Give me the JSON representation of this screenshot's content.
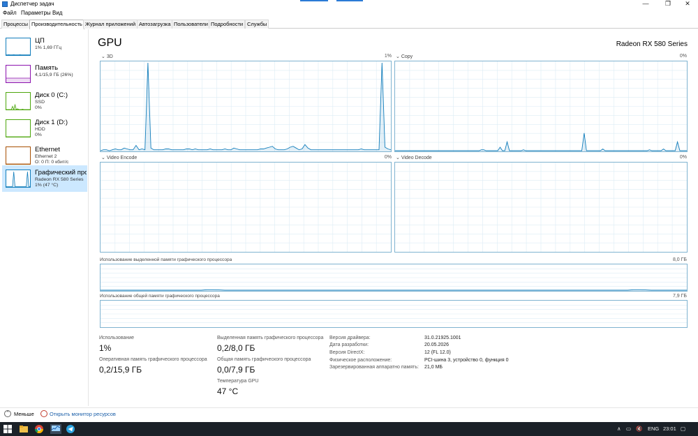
{
  "window": {
    "title": "Диспетчер задач",
    "minimize": "—",
    "maximize": "❐",
    "close": "✕"
  },
  "menu": [
    "Файл",
    "Параметры",
    "Вид"
  ],
  "tabs": [
    "Процессы",
    "Производительность",
    "Журнал приложений",
    "Автозагрузка",
    "Пользователи",
    "Подробности",
    "Службы"
  ],
  "active_tab": "Производительность",
  "sidebar": [
    {
      "name": "ЦП",
      "sub1": "1% 1,69 ГГц",
      "sub2": "",
      "color": "#117dbb"
    },
    {
      "name": "Память",
      "sub1": "4,1/15,9 ГБ (26%)",
      "sub2": "",
      "color": "#8b12ae"
    },
    {
      "name": "Диск 0 (C:)",
      "sub1": "SSD",
      "sub2": "0%",
      "color": "#4da60c"
    },
    {
      "name": "Диск 1 (D:)",
      "sub1": "HDD",
      "sub2": "0%",
      "color": "#4da60c"
    },
    {
      "name": "Ethernet",
      "sub1": "Ethernet 2",
      "sub2": "О: 0 П: 0 кбит/с",
      "color": "#a74f01"
    },
    {
      "name": "Графический про",
      "sub1": "Radeon RX 580 Series",
      "sub2": "1% (47 °C)",
      "color": "#117dbb"
    }
  ],
  "main": {
    "title": "GPU",
    "model": "Radeon RX 580 Series",
    "graphs": {
      "g3d": {
        "label": "3D",
        "value": "1%"
      },
      "copy": {
        "label": "Copy",
        "value": "0%"
      },
      "encode": {
        "label": "Video Encode",
        "value": "0%"
      },
      "decode": {
        "label": "Video Decode",
        "value": "0%"
      },
      "dedicated": {
        "label": "Использование выделенной памяти графического процессора",
        "value": "8,0 ГБ"
      },
      "shared": {
        "label": "Использование общей памяти графического процессора",
        "value": "7,9 ГБ"
      }
    },
    "stats": {
      "usage_label": "Использование",
      "usage": "1%",
      "ram_label": "Оперативная память графического процессора",
      "ram": "0,2/15,9 ГБ",
      "dedicated_label": "Выделенная память графического процессора",
      "dedicated": "0,2/8,0 ГБ",
      "shared_label": "Общая память графического процессора",
      "shared": "0,0/7,9 ГБ",
      "temp_label": "Температура GPU",
      "temp": "47 °C"
    },
    "props": [
      {
        "key": "Версия драйвера:",
        "value": "31.0.21925.1001"
      },
      {
        "key": "Дата разработки:",
        "value": "20.05.2026"
      },
      {
        "key": "Версия DirectX:",
        "value": "12 (FL 12.0)"
      },
      {
        "key": "Физическое расположение:",
        "value": "PCI-шина 3, устройство 0, функция 0"
      },
      {
        "key": "Зарезервированная аппаратно память:",
        "value": "21,0 МБ"
      }
    ]
  },
  "footer": {
    "less": "Меньше",
    "monitor": "Открыть монитор ресурсов"
  },
  "taskbar": {
    "lang": "ENG",
    "time": "23:01"
  },
  "series": {
    "g3d": [
      0,
      1,
      1,
      0,
      1,
      2,
      1,
      1,
      3,
      2,
      1,
      1,
      6,
      1,
      2,
      1,
      100,
      3,
      1,
      1,
      1,
      1,
      2,
      2,
      1,
      1,
      1,
      1,
      1,
      2,
      2,
      1,
      2,
      1,
      1,
      1,
      1,
      2,
      1,
      1,
      1,
      1,
      2,
      1,
      1,
      3,
      2,
      1,
      1,
      1,
      1,
      1,
      1,
      1,
      2,
      2,
      3,
      4,
      5,
      2,
      1,
      1,
      1,
      2,
      4,
      5,
      3,
      1,
      2,
      7,
      3,
      1,
      1,
      1,
      1,
      1,
      1,
      1,
      1,
      1,
      1,
      1,
      1,
      1,
      1,
      1,
      1,
      1,
      2,
      1,
      1,
      1,
      1,
      1,
      1,
      100,
      4,
      2,
      1
    ],
    "copy": [
      0,
      0,
      0,
      0,
      0,
      0,
      0,
      0,
      0,
      0,
      0,
      0,
      0,
      0,
      0,
      0,
      0,
      0,
      0,
      0,
      0,
      0,
      0,
      0,
      0,
      0,
      0,
      0,
      0,
      0,
      0,
      0,
      0,
      0,
      0,
      0,
      0,
      1,
      1,
      0,
      0,
      0,
      0,
      0,
      0,
      4,
      0,
      0,
      10,
      0,
      0,
      0,
      0,
      0,
      0,
      1,
      0,
      0,
      0,
      0,
      0,
      0,
      0,
      0,
      0,
      0,
      0,
      0,
      0,
      0,
      0,
      0,
      0,
      0,
      0,
      0,
      0,
      0,
      0,
      0,
      0,
      20,
      0,
      0,
      0,
      0,
      0,
      0,
      0,
      2,
      0,
      0,
      0,
      0,
      0,
      0,
      0,
      0,
      0,
      0,
      0,
      0,
      0,
      0,
      0,
      0,
      0,
      0,
      0,
      1,
      0,
      0,
      0,
      0,
      0,
      2,
      0,
      0,
      0,
      0,
      0,
      10,
      0,
      0,
      0,
      0
    ]
  }
}
